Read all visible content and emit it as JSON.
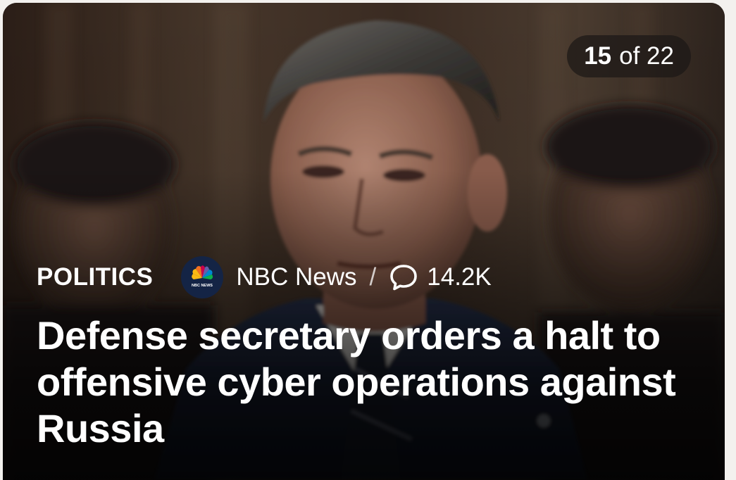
{
  "counter": {
    "current": "15",
    "rest": "of 22"
  },
  "article": {
    "category": "POLITICS",
    "source_name": "NBC News",
    "source_logo_text": "NBC NEWS",
    "divider": "/",
    "comment_count": "14.2K",
    "headline": "Defense secretary orders a halt to offensive cyber operations against Russia"
  },
  "icons": {
    "source_logo": "nbc-peacock-logo",
    "comments": "speech-bubble-icon"
  },
  "colors": {
    "text": "#ffffff",
    "counter_bg": "#1c1816",
    "logo_bg": "#142445"
  }
}
